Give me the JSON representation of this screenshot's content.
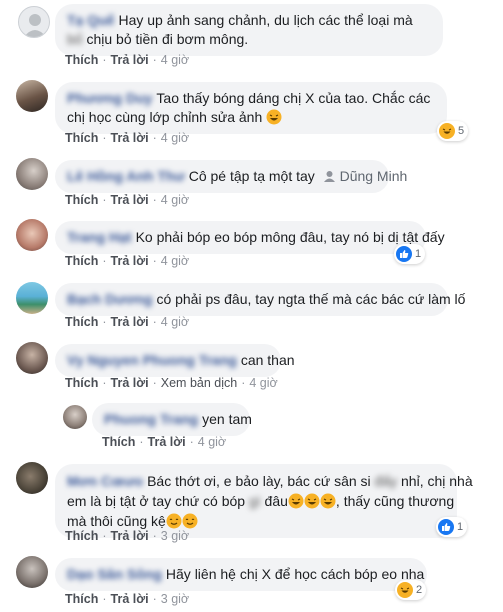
{
  "comments": [
    {
      "author": "Tạ Quế",
      "text_a": "Hay up ảnh sang chảnh, du lịch các thể loại mà ",
      "hidden": "bố",
      "text_b": " chịu bỏ tiền đi bơm mông.",
      "actions": {
        "like": "Thích",
        "reply": "Trả lời",
        "time": "4 giờ"
      }
    },
    {
      "author": "Phương Duy",
      "text": "Tao thấy bóng dáng chị X của tao. Chắc các chị học cùng lớp chỉnh sửa ảnh",
      "actions": {
        "like": "Thích",
        "reply": "Trả lời",
        "time": "4 giờ"
      },
      "reaction_count": "5"
    },
    {
      "author": "Lê Hồng Anh Thư",
      "text": "Cô pé tập tạ một tay",
      "tag_name": "Dũng Minh",
      "actions": {
        "like": "Thích",
        "reply": "Trả lời",
        "time": "4 giờ"
      }
    },
    {
      "author": "Trang Hạt",
      "text": "Ko phải bóp eo bóp mông đâu, tay nó bị dị tật đấy",
      "actions": {
        "like": "Thích",
        "reply": "Trả lời",
        "time": "4 giờ"
      },
      "reaction_count": "1"
    },
    {
      "author": "Bạch Dương",
      "text": "có phải ps đâu, tay ngta thế mà các bác cứ làm lố",
      "actions": {
        "like": "Thích",
        "reply": "Trả lời",
        "time": "4 giờ"
      }
    },
    {
      "author": "Vy Nguyen Phuong Trang",
      "text": "can than",
      "actions": {
        "like": "Thích",
        "reply": "Trả lời",
        "translate": "Xem bản dịch",
        "time": "4 giờ"
      }
    },
    {
      "author": "Phuong Trang",
      "text": "yen tam",
      "actions": {
        "like": "Thích",
        "reply": "Trả lời",
        "time": "4 giờ"
      }
    },
    {
      "author": "Mơn Cœưo",
      "line1_a": "Bác thớt ơi, e bảo lày, bác cứ sân si ",
      "line1_hidden": "đấy",
      "line1_b": " nhỉ, chị nhà",
      "line2_a": "em là bị tật ở tay chứ có bóp ",
      "line2_hidden": "gì",
      "line2_b": " đâu",
      "line2_c": ", thấy cũng thương",
      "line3": "mà thôi cũng kệ",
      "actions": {
        "like": "Thích",
        "reply": "Trả lời",
        "time": "3 giờ"
      },
      "reaction_count": "1"
    },
    {
      "author": "Dạo Sân Sông",
      "text": "Hãy liên hệ chị X để học cách bóp eo nha",
      "actions": {
        "like": "Thích",
        "reply": "Trả lời",
        "time": "3 giờ"
      },
      "reaction_count": "2"
    }
  ],
  "colors": {
    "bubble": "#f2f3f5",
    "link": "#3b5998",
    "like_blue": "#1877f2",
    "haha_yellow": "#f7b125"
  }
}
